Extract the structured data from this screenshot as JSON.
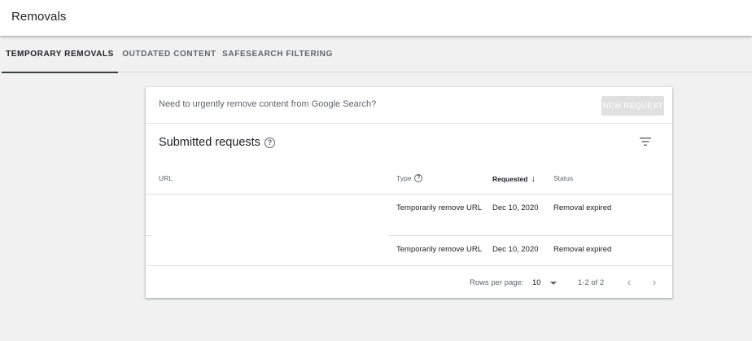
{
  "header": {
    "title": "Removals"
  },
  "tabs": [
    {
      "label": "TEMPORARY REMOVALS",
      "active": true
    },
    {
      "label": "OUTDATED CONTENT",
      "active": false
    },
    {
      "label": "SAFESEARCH FILTERING",
      "active": false
    }
  ],
  "banner": {
    "text": "Need to urgently remove content from Google Search?",
    "button_label": "NEW REQUEST"
  },
  "requests": {
    "title": "Submitted requests",
    "help_icon": "help-circle-icon",
    "filter_icon": "filter-list-icon",
    "columns": {
      "url": "URL",
      "type": "Type",
      "requested": "Requested",
      "status": "Status"
    },
    "rows": [
      {
        "url": "",
        "type": "Temporarily remove URL",
        "requested": "Dec 10, 2020",
        "status": "Removal expired"
      },
      {
        "url": "",
        "type": "Temporarily remove URL",
        "requested": "Dec 10, 2020",
        "status": "Removal expired"
      }
    ],
    "pagination": {
      "rows_per_page_label": "Rows per page:",
      "rows_per_page_value": "10",
      "range": "1-2 of 2"
    }
  },
  "colors": {
    "background": "#f1f1f1",
    "card": "#ffffff",
    "disabled_button": "#e0e0e0",
    "active_tab_indicator": "#3c4043"
  }
}
